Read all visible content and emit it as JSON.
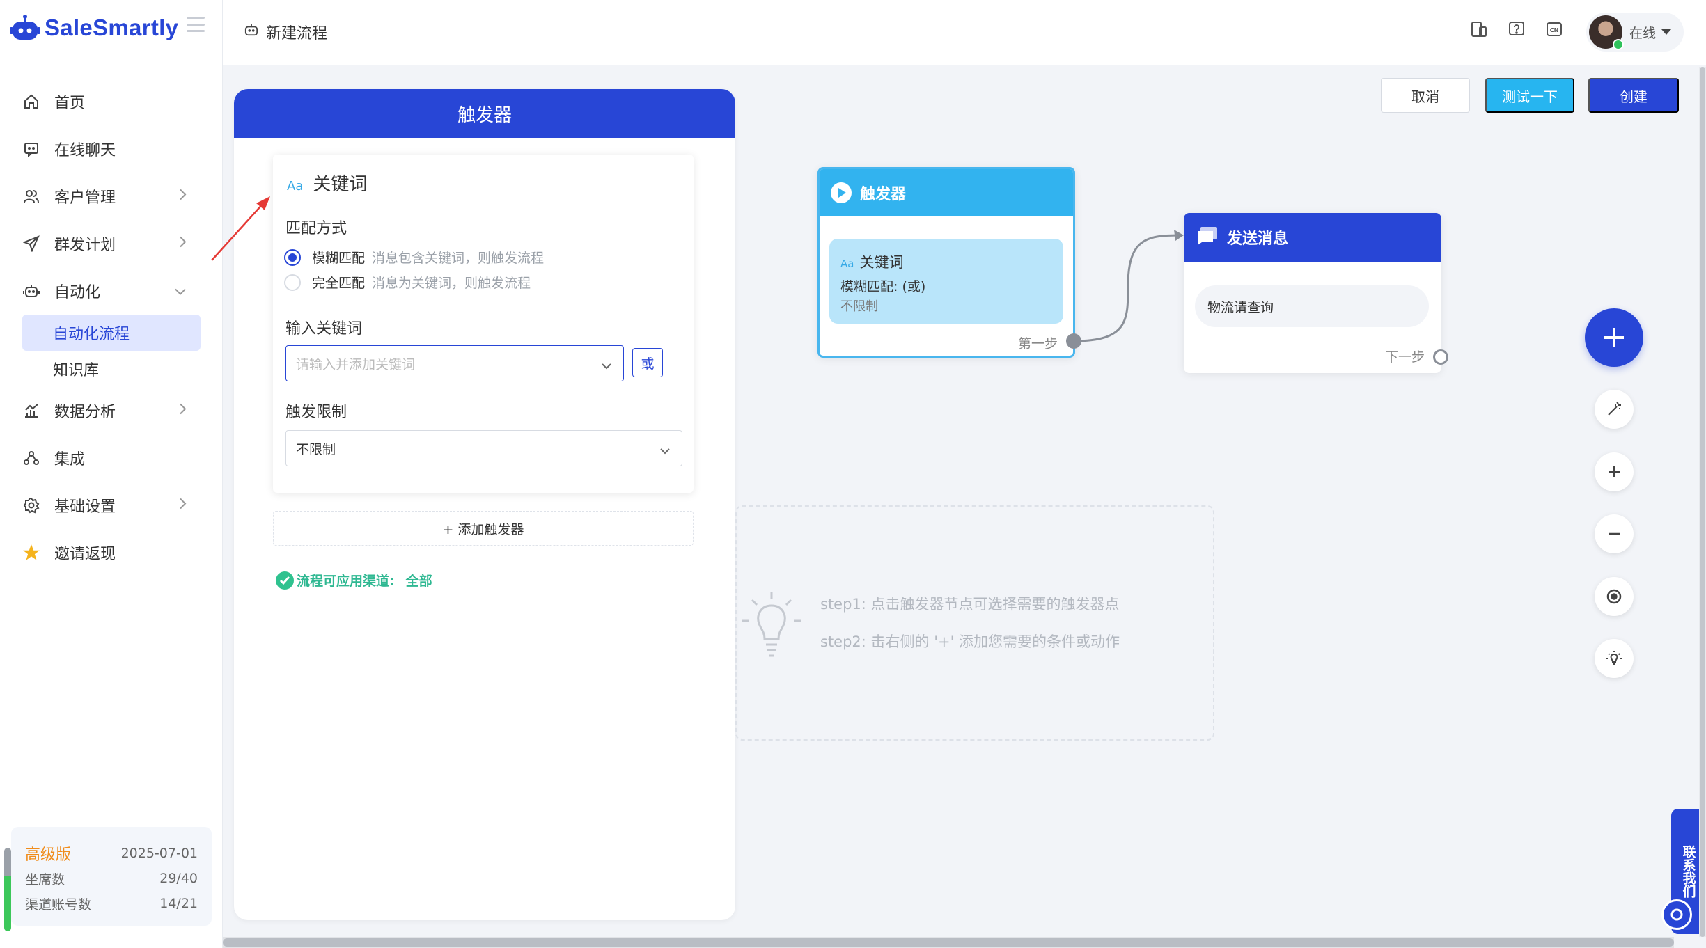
{
  "app": {
    "name": "SaleSmartly",
    "brand_color": "#2846d6"
  },
  "sidebar": {
    "items": [
      {
        "label": "首页",
        "icon": "home-icon"
      },
      {
        "label": "在线聊天",
        "icon": "chat-icon"
      },
      {
        "label": "客户管理",
        "icon": "users-icon",
        "expandable": true
      },
      {
        "label": "群发计划",
        "icon": "send-icon",
        "expandable": true
      },
      {
        "label": "自动化",
        "icon": "robot-icon",
        "expanded": true
      },
      {
        "label": "数据分析",
        "icon": "chart-icon",
        "expandable": true
      },
      {
        "label": "集成",
        "icon": "integration-icon"
      },
      {
        "label": "基础设置",
        "icon": "gear-icon",
        "expandable": true
      },
      {
        "label": "邀请返现",
        "icon": "star-icon"
      }
    ],
    "sub_items": [
      {
        "label": "自动化流程",
        "active": true
      },
      {
        "label": "知识库"
      }
    ],
    "plan": {
      "tier": "高级版",
      "expiry": "2025-07-01",
      "seats_label": "坐席数",
      "seats_value": "29/40",
      "channels_label": "渠道账号数",
      "channels_value": "14/21"
    }
  },
  "header": {
    "title": "新建流程",
    "user_status": "在线"
  },
  "actions": {
    "cancel": "取消",
    "test": "测试一下",
    "create": "创建"
  },
  "trigger_panel": {
    "title": "触发器",
    "keyword_card": {
      "aa": "Aa",
      "title": "关键词",
      "match_label": "匹配方式",
      "options": [
        {
          "main": "模糊匹配",
          "hint": "消息包含关键词，则触发流程",
          "selected": true
        },
        {
          "main": "完全匹配",
          "hint": "消息为关键词，则触发流程",
          "selected": false
        }
      ],
      "input_label": "输入关键词",
      "input_placeholder": "请输入并添加关键词",
      "or_button": "或",
      "limit_label": "触发限制",
      "limit_value": "不限制"
    },
    "add_trigger": "+ 添加触发器",
    "channel_label": "流程可应用渠道:",
    "channel_value": "全部"
  },
  "canvas": {
    "trigger_node": {
      "title": "触发器",
      "aa": "Aa",
      "keyword": "关键词",
      "match": "模糊匹配: (或)",
      "limit": "不限制",
      "step_label": "第一步"
    },
    "message_node": {
      "title": "发送消息",
      "content": "物流请查询",
      "step_label": "下一步"
    },
    "guide": {
      "step1": "step1: 点击触发器节点可选择需要的触发器点",
      "step2": "step2: 击右侧的 '+' 添加您需要的条件或动作"
    }
  },
  "contact": {
    "label": "联系我们"
  }
}
